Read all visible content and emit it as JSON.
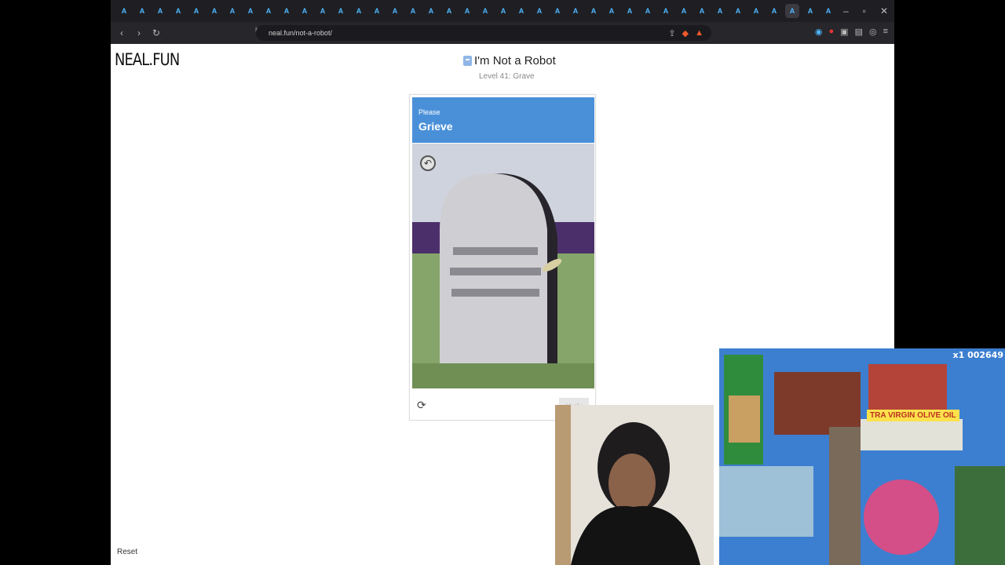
{
  "browser": {
    "url": "neal.fun/not-a-robot/",
    "tabs": [
      "A",
      "A",
      "A",
      "A",
      "A",
      "A",
      "A",
      "A",
      "A",
      "A",
      "A",
      "A",
      "A",
      "A",
      "A",
      "A",
      "A",
      "A",
      "A",
      "A",
      "A",
      "A",
      "A",
      "A",
      "A",
      "A",
      "A",
      "A",
      "A",
      "A",
      "A",
      "A",
      "A",
      "A",
      "A",
      "A",
      "A",
      "A",
      "A",
      "A"
    ]
  },
  "page": {
    "logo": "NEAL.FUN",
    "title": "I'm Not a Robot",
    "subtitle": "Level 41: Grave",
    "reset_label": "Reset"
  },
  "captcha": {
    "prompt_small": "Please",
    "prompt_big": "Grieve",
    "verify_label": "Verify"
  },
  "gameplay": {
    "score_text": "x1 002649",
    "sign_text": "TRA VIRGIN OLIVE OIL"
  }
}
